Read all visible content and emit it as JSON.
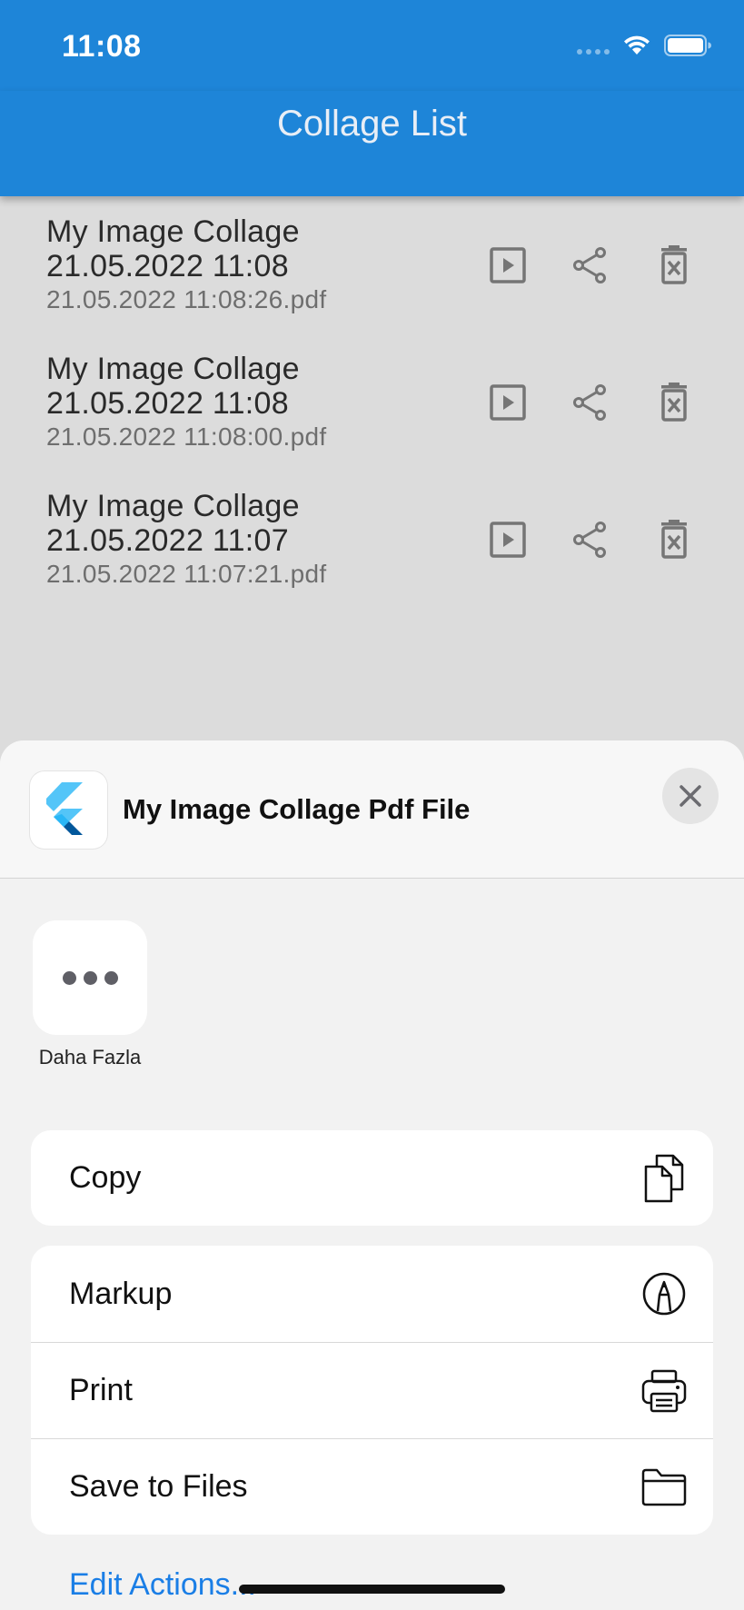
{
  "status_bar": {
    "time": "11:08"
  },
  "app_bar": {
    "title": "Collage List"
  },
  "collages": [
    {
      "title_line1": "My Image Collage",
      "title_line2": "21.05.2022 11:08",
      "filename": "21.05.2022 11:08:26.pdf"
    },
    {
      "title_line1": "My Image Collage",
      "title_line2": "21.05.2022 11:08",
      "filename": "21.05.2022 11:08:00.pdf"
    },
    {
      "title_line1": "My Image Collage",
      "title_line2": "21.05.2022 11:07",
      "filename": "21.05.2022 11:07:21.pdf"
    }
  ],
  "share_sheet": {
    "title": "My Image Collage Pdf File",
    "more_label": "Daha Fazla",
    "actions": [
      {
        "label": "Copy",
        "icon": "copy-icon"
      },
      {
        "label": "Markup",
        "icon": "markup-icon"
      },
      {
        "label": "Print",
        "icon": "print-icon"
      },
      {
        "label": "Save to Files",
        "icon": "folder-icon"
      }
    ],
    "edit_actions": "Edit Actions..."
  },
  "colors": {
    "app_bar": "#1e85d8",
    "link": "#1a7ee6",
    "list_background": "#dcdcdc"
  }
}
